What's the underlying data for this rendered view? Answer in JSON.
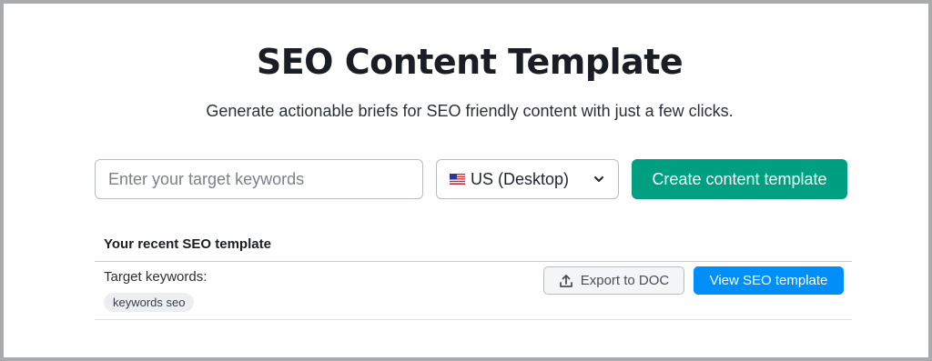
{
  "header": {
    "title": "SEO Content Template",
    "subtitle": "Generate actionable briefs for SEO friendly content with just a few clicks."
  },
  "search": {
    "placeholder": "Enter your target keywords",
    "value": ""
  },
  "database_select": {
    "flag_icon": "us-flag-icon",
    "selected": "US (Desktop)",
    "chevron_icon": "chevron-down-icon"
  },
  "create_button": {
    "label": "Create content template",
    "color": "#009f81"
  },
  "recent": {
    "heading": "Your recent SEO template",
    "items": [
      {
        "target_label": "Target keywords:",
        "keywords": [
          "keywords seo"
        ],
        "export_label": "Export to DOC",
        "export_icon": "upload-icon",
        "view_label": "View SEO template",
        "view_color": "#008ff8"
      }
    ]
  }
}
